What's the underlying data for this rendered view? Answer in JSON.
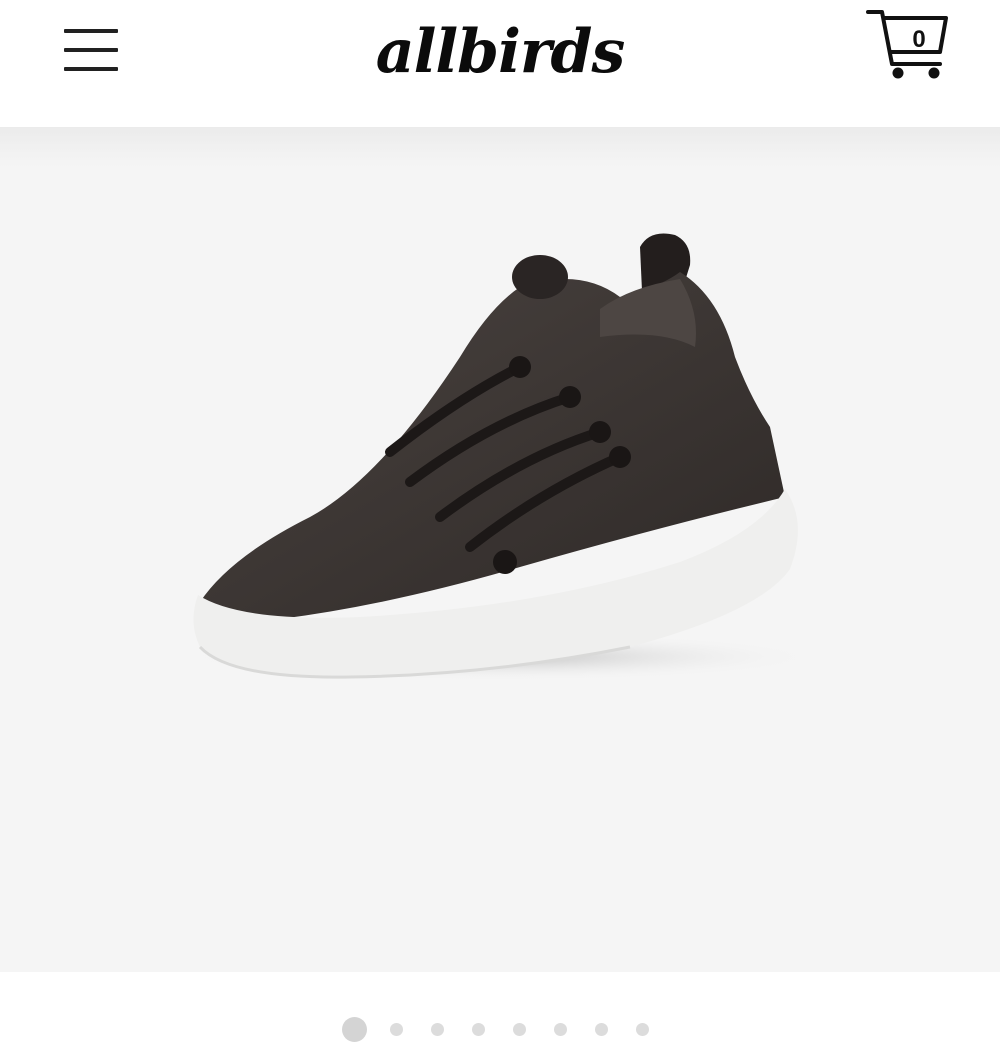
{
  "header": {
    "menu_icon": "hamburger-menu-icon",
    "logo_text": "allbirds",
    "cart_icon": "shopping-cart-icon",
    "cart_count": "0"
  },
  "product": {
    "image_icon": "wool-runner-sneaker-image",
    "colors": {
      "upper": "#3a3432",
      "sole": "#f0f0ef",
      "background": "#f5f5f5"
    }
  },
  "carousel": {
    "total_slides": 8,
    "active_slide": 1
  }
}
